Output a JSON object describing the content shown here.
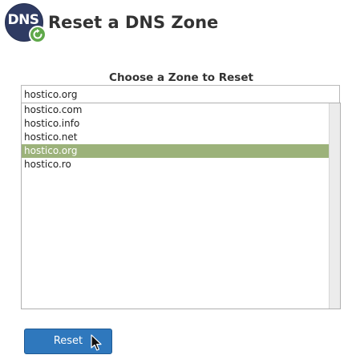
{
  "header": {
    "logo_text": "DNS",
    "logo_icon": "refresh-badge-icon",
    "title": "Reset a DNS Zone"
  },
  "form": {
    "zone_label": "Choose a Zone to Reset",
    "filter_value": "hostico.org",
    "zones": [
      "hostico.com",
      "hostico.info",
      "hostico.net",
      "hostico.org",
      "hostico.ro"
    ],
    "selected_zone": "hostico.org",
    "submit_label": "Reset"
  },
  "colors": {
    "logo_bg": "#2f3b63",
    "badge_green": "#5fa84a",
    "selected_row": "#9cb27a",
    "button_bg": "#2f78bd"
  }
}
